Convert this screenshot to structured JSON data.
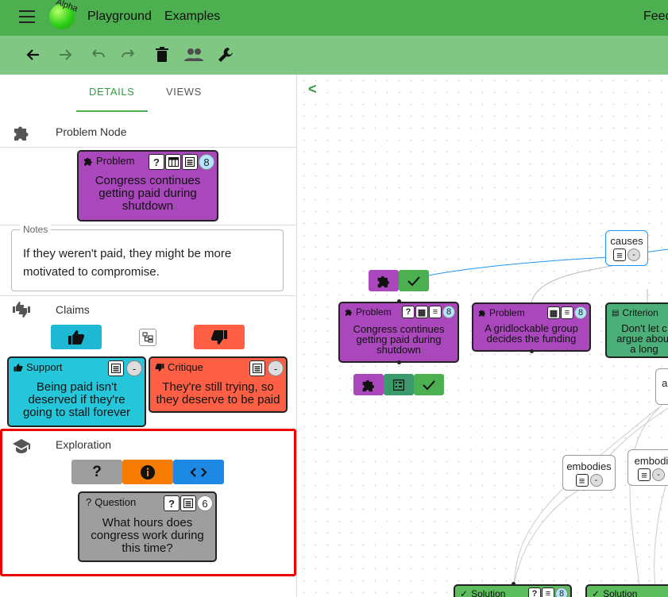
{
  "app": {
    "logo_badge": "Alpha",
    "nav": [
      "Playground",
      "Examples"
    ],
    "feedback_partial": "Feed"
  },
  "toolbar": {
    "icons": [
      "back-arrow-icon",
      "forward-arrow-icon",
      "undo-icon",
      "redo-icon",
      "trash-icon",
      "people-icon",
      "wrench-icon"
    ]
  },
  "tabs": {
    "details": "DETAILS",
    "views": "VIEWS"
  },
  "details": {
    "section_title": "Problem Node",
    "selected_node": {
      "type_label": "Problem",
      "badge_count": "8",
      "text": "Congress continues getting paid during shutdown",
      "color": "#ab47bc"
    },
    "notes": {
      "label": "Notes",
      "text": "If they weren't paid, they might be more motivated to compromise."
    },
    "claims": {
      "title": "Claims",
      "support": {
        "type_label": "Support",
        "text": "Being paid isn't deserved if they're going to stall forever",
        "color": "#26c6da"
      },
      "critique": {
        "type_label": "Critique",
        "text": "They're still trying, so they deserve to be paid",
        "color": "#ff5f45"
      }
    },
    "exploration": {
      "title": "Exploration",
      "question_button": "?",
      "question": {
        "type_label": "Question",
        "badge_count": "6",
        "text": "What hours does congress work during this time?",
        "color": "#9e9e9e"
      }
    }
  },
  "canvas": {
    "back_chevron": "<",
    "edges": {
      "causes": "causes",
      "embodies1": "embodies",
      "embodies2": "embodi",
      "addresses_partial": "ac"
    },
    "nodes": {
      "problem1": {
        "type_label": "Problem",
        "badge_count": "8",
        "text": "Congress continues getting paid during shutdown"
      },
      "problem2": {
        "type_label": "Problem",
        "badge_count": "8",
        "text": "A gridlockable group decides the funding"
      },
      "criterion": {
        "type_label": "Criterion",
        "text": "Don't let c argue about a long"
      },
      "solution1": {
        "type_label": "Solution",
        "badge_count": "8"
      },
      "solution2": {
        "type_label": "Solution"
      }
    },
    "colors": {
      "problem": "#ab47bc",
      "criterion": "#4caf7a",
      "solution": "#5cbd5c",
      "edge_blue": "#2196f3"
    }
  }
}
